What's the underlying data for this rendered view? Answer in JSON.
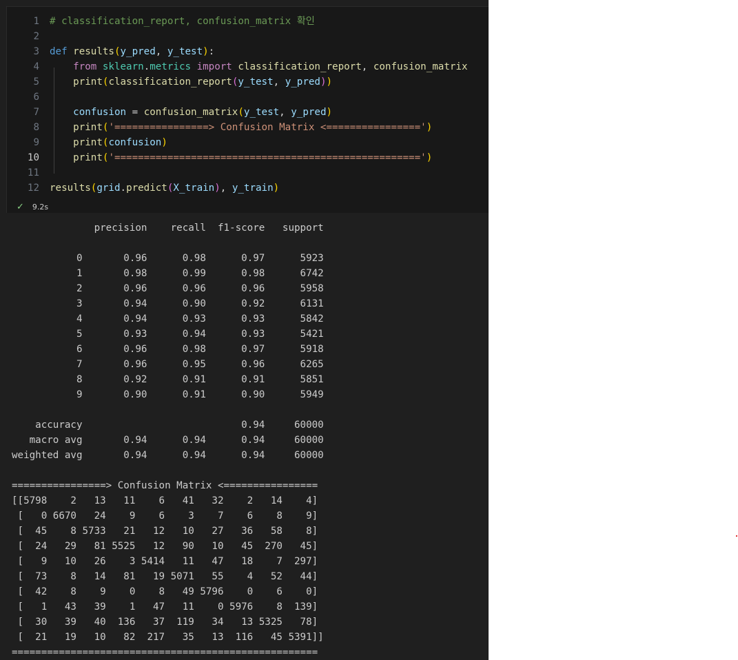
{
  "cell": {
    "lines": [
      {
        "n": "1",
        "code": "# classification_report, confusion_matrix 확인"
      },
      {
        "n": "2",
        "code": ""
      },
      {
        "n": "3",
        "code": "def results(y_pred, y_test):"
      },
      {
        "n": "4",
        "code": "    from sklearn.metrics import classification_report, confusion_matrix"
      },
      {
        "n": "5",
        "code": "    print(classification_report(y_test, y_pred))"
      },
      {
        "n": "6",
        "code": ""
      },
      {
        "n": "7",
        "code": "    confusion = confusion_matrix(y_test, y_pred)"
      },
      {
        "n": "8",
        "code": "    print('================> Confusion Matrix <================')"
      },
      {
        "n": "9",
        "code": "    print(confusion)"
      },
      {
        "n": "10",
        "code": "    print('====================================================')"
      },
      {
        "n": "11",
        "code": ""
      },
      {
        "n": "12",
        "code": "results(grid.predict(X_train), y_train)"
      }
    ],
    "active_line": "10",
    "exec_time": "9.2s"
  },
  "output": {
    "lines": [
      "              precision    recall  f1-score   support",
      "",
      "           0       0.96      0.98      0.97      5923",
      "           1       0.98      0.99      0.98      6742",
      "           2       0.96      0.96      0.96      5958",
      "           3       0.94      0.90      0.92      6131",
      "           4       0.94      0.93      0.93      5842",
      "           5       0.93      0.94      0.93      5421",
      "           6       0.96      0.98      0.97      5918",
      "           7       0.96      0.95      0.96      6265",
      "           8       0.92      0.91      0.91      5851",
      "           9       0.90      0.91      0.90      5949",
      "",
      "    accuracy                           0.94     60000",
      "   macro avg       0.94      0.94      0.94     60000",
      "weighted avg       0.94      0.94      0.94     60000",
      "",
      "================> Confusion Matrix <================",
      "[[5798    2   13   11    6   41   32    2   14    4]",
      " [   0 6670   24    9    6    3    7    6    8    9]",
      " [  45    8 5733   21   12   10   27   36   58    8]",
      " [  24   29   81 5525   12   90   10   45  270   45]",
      " [   9   10   26    3 5414   11   47   18    7  297]",
      " [  73    8   14   81   19 5071   55    4   52   44]",
      " [  42    8    9    0    8   49 5796    0    6    0]",
      " [   1   43   39    1   47   11    0 5976    8  139]",
      " [  30   39   40  136   37  119   34   13 5325   78]",
      " [  21   19   10   82  217   35   13  116   45 5391]]",
      "===================================================="
    ]
  },
  "colors": {
    "notebook_bg": "#1f1f1f",
    "cell_bg": "#181818",
    "comment": "#6a9955",
    "keyword": "#569cd6",
    "function": "#dcdcaa",
    "string": "#ce9178",
    "success_check": "#89d185"
  },
  "icons": {
    "status": "check-icon"
  }
}
